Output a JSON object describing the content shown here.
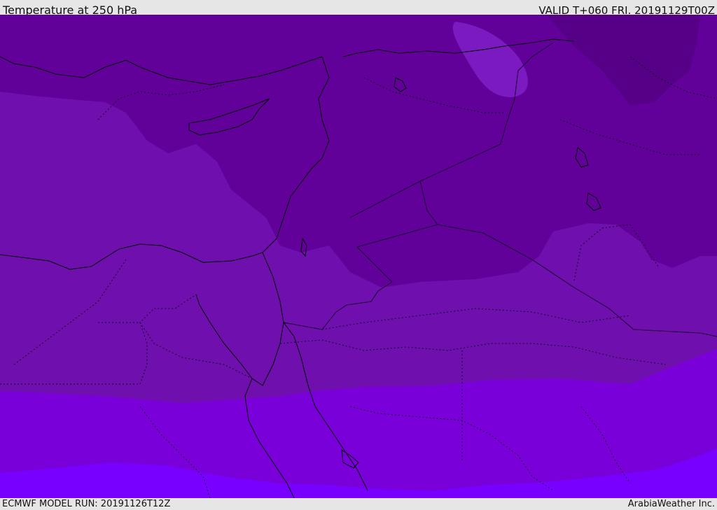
{
  "header": {
    "title": "Temperature at 250 hPa",
    "valid": "VALID T+060 FRI. 20191129T00Z"
  },
  "footer": {
    "model_run": "ECMWF MODEL RUN: 20191126T12Z",
    "credit": "ArabiaWeather Inc."
  },
  "map": {
    "colors": {
      "band_darkest": "#560088",
      "band_dark": "#62009a",
      "band_mid": "#6e0fae",
      "band_light": "#7a00da",
      "band_lightest": "#7800ff",
      "lighter_patch": "#7a1ac0",
      "coastline": "#000000",
      "border": "#1a0030"
    }
  }
}
